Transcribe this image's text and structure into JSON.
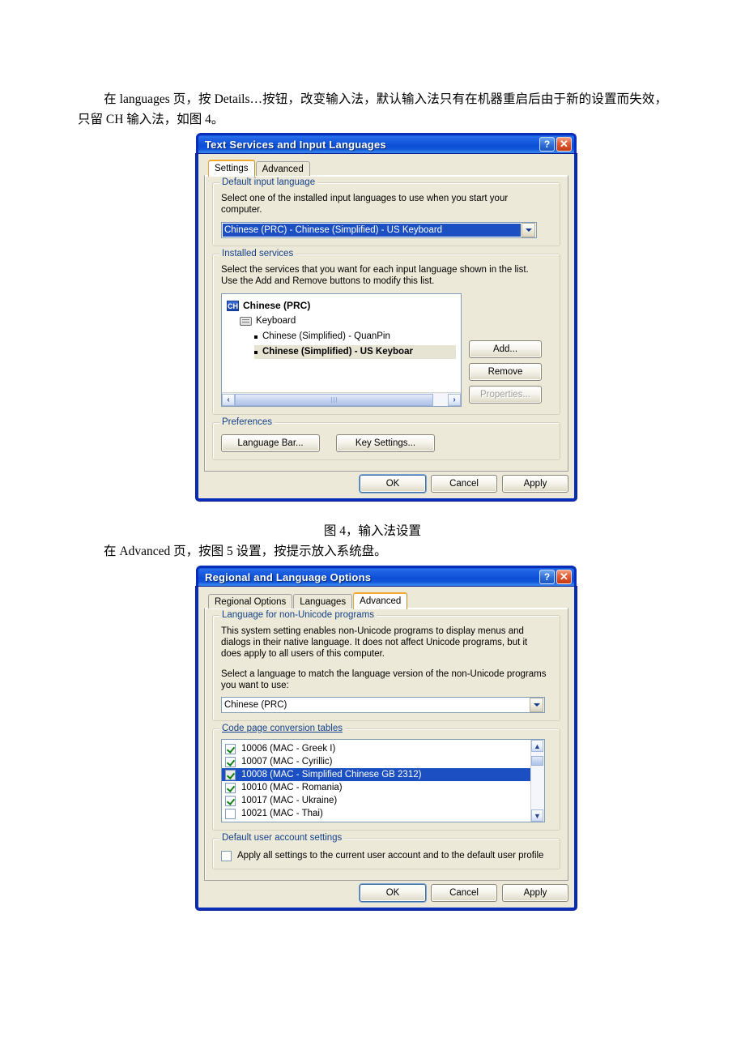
{
  "document": {
    "para1": "在 languages 页，按 Details…按钮，改变输入法，默认输入法只有在机器重启后由于新的设置而失效，只留 CH 输入法，如图 4。",
    "caption1": "图 4，输入法设置",
    "para2": "在 Advanced 页，按图 5 设置，按提示放入系统盘。"
  },
  "dialog1": {
    "title": "Text Services and Input Languages",
    "help_glyph": "?",
    "close_glyph": "✕",
    "tabs": [
      {
        "label": "Settings",
        "active": true
      },
      {
        "label": "Advanced",
        "active": false
      }
    ],
    "default_input_language": {
      "group_title": "Default input language",
      "description": "Select one of the installed input languages to use when you start your computer.",
      "value": "Chinese (PRC) - Chinese (Simplified) - US Keyboard"
    },
    "installed_services": {
      "group_title": "Installed services",
      "description": "Select the services that you want for each input language shown in the list. Use the Add and Remove buttons to modify this list.",
      "tree": {
        "language_badge": "CH",
        "language_label": "Chinese (PRC)",
        "category_label": "Keyboard",
        "items": [
          {
            "label": "Chinese (Simplified) - QuanPin",
            "selected": false
          },
          {
            "label": "Chinese (Simplified) - US Keyboar",
            "selected": true
          }
        ]
      },
      "buttons": [
        {
          "label": "Add...",
          "disabled": false
        },
        {
          "label": "Remove",
          "disabled": false
        },
        {
          "label": "Properties...",
          "disabled": true
        }
      ]
    },
    "preferences": {
      "group_title": "Preferences",
      "buttons": [
        {
          "label": "Language Bar..."
        },
        {
          "label": "Key Settings..."
        }
      ]
    },
    "footer_buttons": [
      {
        "label": "OK",
        "default": true
      },
      {
        "label": "Cancel",
        "default": false
      },
      {
        "label": "Apply",
        "default": false
      }
    ]
  },
  "dialog2": {
    "title": "Regional and Language Options",
    "help_glyph": "?",
    "close_glyph": "✕",
    "tabs": [
      {
        "label": "Regional Options",
        "active": false
      },
      {
        "label": "Languages",
        "active": false
      },
      {
        "label": "Advanced",
        "active": true
      }
    ],
    "non_unicode": {
      "group_title": "Language for non-Unicode programs",
      "description": "This system setting enables non-Unicode programs to display menus and dialogs in their native language. It does not affect Unicode programs, but it does apply to all users of this computer.",
      "prompt": "Select a language to match the language version of the non-Unicode programs you want to use:",
      "value": "Chinese (PRC)"
    },
    "code_pages": {
      "group_title": "Code page conversion tables",
      "rows": [
        {
          "label": "10006 (MAC - Greek I)",
          "checked": true,
          "selected": false
        },
        {
          "label": "10007 (MAC - Cyrillic)",
          "checked": true,
          "selected": false
        },
        {
          "label": "10008 (MAC - Simplified Chinese GB 2312)",
          "checked": true,
          "selected": true
        },
        {
          "label": "10010 (MAC - Romania)",
          "checked": true,
          "selected": false
        },
        {
          "label": "10017 (MAC - Ukraine)",
          "checked": true,
          "selected": false
        },
        {
          "label": "10021 (MAC - Thai)",
          "checked": false,
          "selected": false
        }
      ]
    },
    "default_user": {
      "group_title": "Default user account settings",
      "checkbox_label": "Apply all settings to the current user account and to the default user profile",
      "checked": false
    },
    "footer_buttons": [
      {
        "label": "OK",
        "default": true
      },
      {
        "label": "Cancel",
        "default": false
      },
      {
        "label": "Apply",
        "default": false
      }
    ]
  },
  "colors": {
    "titlebar_blue": "#1458dd",
    "dialog_face": "#ece9d8",
    "group_title_blue": "#15428b",
    "selection_blue": "#1c4fc1",
    "active_tab_orange": "#f0a82e",
    "close_red": "#e25c34"
  }
}
